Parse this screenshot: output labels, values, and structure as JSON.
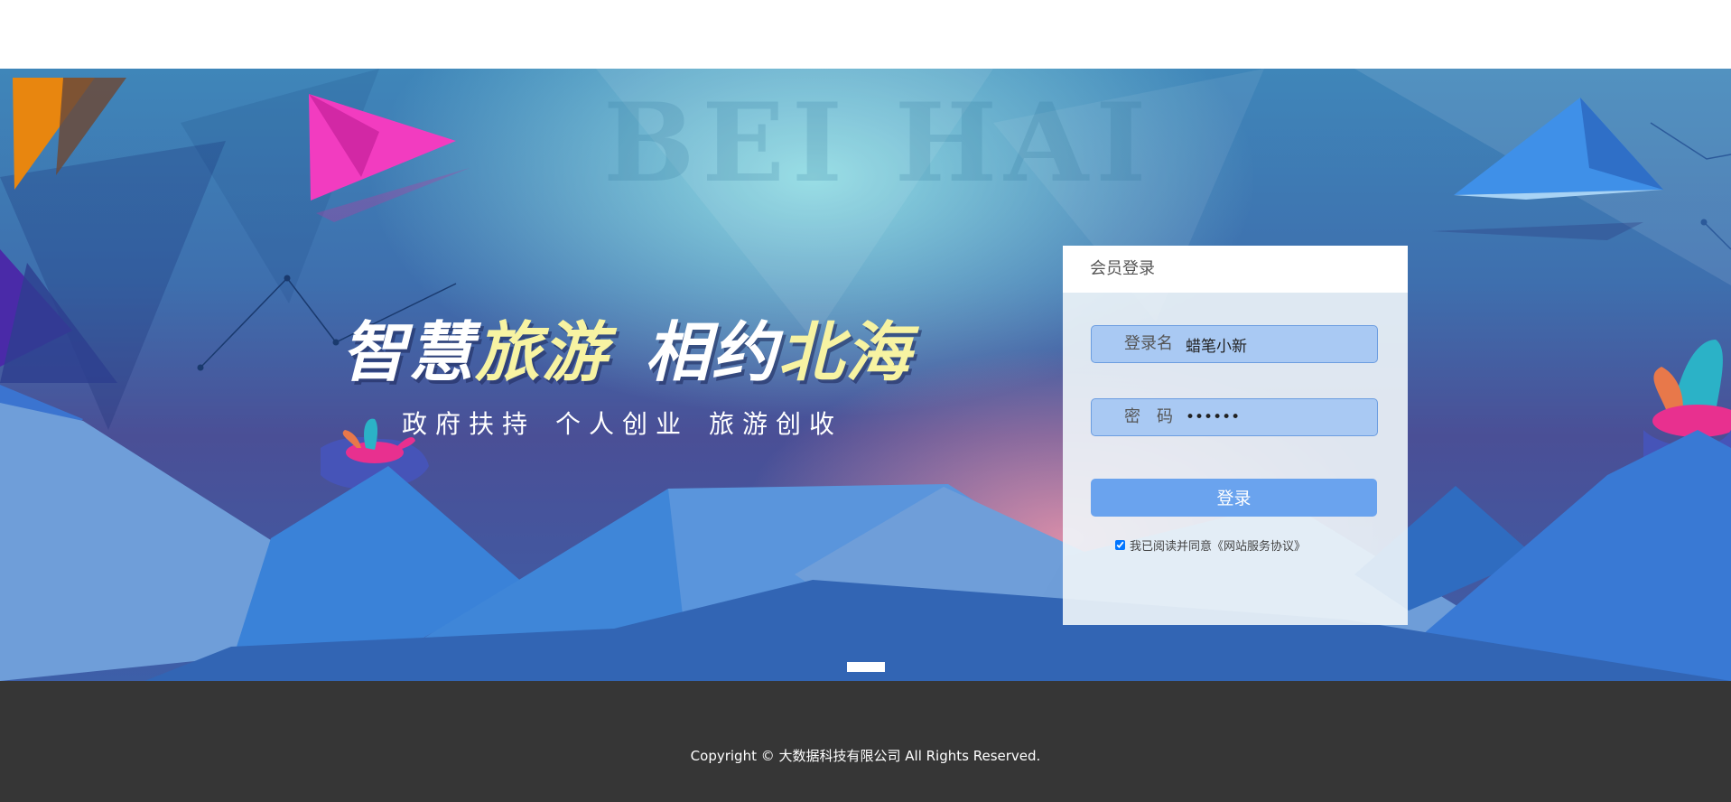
{
  "banner": {
    "watermark": "BEI HAI",
    "headline": {
      "part1": "智慧",
      "part2": "旅游",
      "part3": "相约",
      "part4": "北海"
    },
    "subline": {
      "part1": "政府扶持",
      "part2": "个人创业",
      "part3": "旅游创收"
    },
    "colors": {
      "headline_white": "#ffffff",
      "headline_yellow": "#f7f3a2"
    }
  },
  "login": {
    "title": "会员登录",
    "username_label": "登录名",
    "username_value": "蜡笔小新",
    "password_label": "密码",
    "password_value": "••••••",
    "submit_label": "登录",
    "agreement_text": "我已阅读并同意《网站服务协议》",
    "agreement_checked": true,
    "colors": {
      "field_bg": "#a9c9f3",
      "button_bg": "#6aa3ee"
    }
  },
  "carousel": {
    "active_index": 1,
    "total": 1
  },
  "footer": {
    "copyright": "Copyright © 大数据科技有限公司 All Rights Reserved."
  }
}
